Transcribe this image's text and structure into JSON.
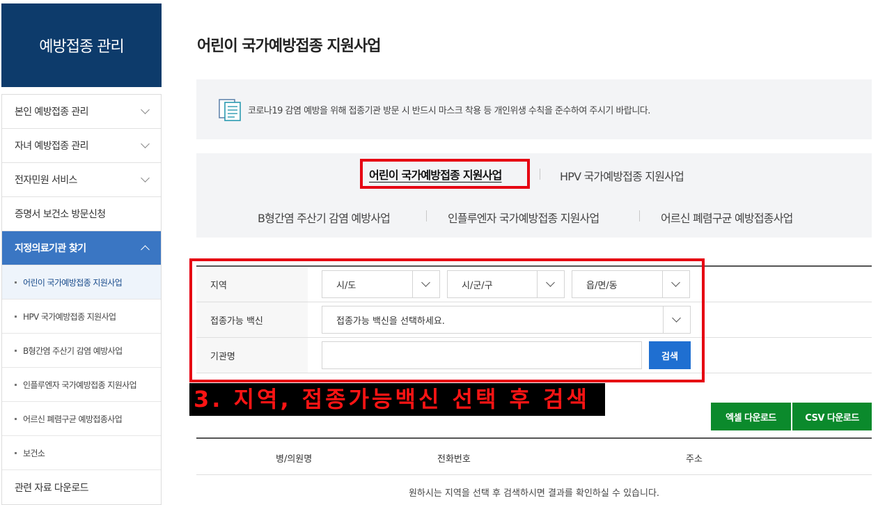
{
  "sidebar": {
    "title": "예방접종 관리",
    "items": [
      {
        "label": "본인 예방접종 관리"
      },
      {
        "label": "자녀 예방접종 관리"
      },
      {
        "label": "전자민원 서비스"
      },
      {
        "label": "증명서 보건소 방문신청"
      },
      {
        "label": "지정의료기관 찾기"
      }
    ],
    "sub_items": [
      {
        "label": "어린이 국가예방접종 지원사업"
      },
      {
        "label": "HPV 국가예방접종 지원사업"
      },
      {
        "label": "B형간염 주산기 감염 예방사업"
      },
      {
        "label": "인플루엔자 국가예방접종 지원사업"
      },
      {
        "label": "어르신 폐렴구균 예방접종사업"
      },
      {
        "label": "보건소"
      }
    ],
    "footer_item": {
      "label": "관련 자료 다운로드"
    }
  },
  "main": {
    "title": "어린이 국가예방접종 지원사업",
    "notice": "코로나19 감염 예방을 위해 접종기관 방문 시 반드시 마스크 착용 등 개인위생 수칙을 준수하여 주시기 바랍니다.",
    "tabs": [
      {
        "label": "어린이 국가예방접종 지원사업"
      },
      {
        "label": "HPV 국가예방접종 지원사업"
      },
      {
        "label": "B형간염 주산기 감염 예방사업"
      },
      {
        "label": "인플루엔자 국가예방접종 지원사업"
      },
      {
        "label": "어르신 폐렴구균 예방접종사업"
      }
    ],
    "form": {
      "region_label": "지역",
      "sido": "시/도",
      "sigungu": "시/군/구",
      "dong": "읍/면/동",
      "vaccine_label": "접종가능 백신",
      "vaccine_value": "접종가능 백신을 선택하세요.",
      "org_label": "기관명",
      "org_value": "",
      "search_label": "검색"
    },
    "annotation": "3. 지역, 접종가능백신 선택 후 검색",
    "excel_label": "엑셀 다운로드",
    "csv_label": "CSV 다운로드",
    "table": {
      "columns": [
        "병/의원명",
        "전화번호",
        "주소"
      ],
      "empty": "원하시는 지역을 선택 후 검색하시면 결과를 확인하실 수 있습니다."
    }
  },
  "colors": {
    "header_navy": "#0d3b6b",
    "active_blue": "#3a76c3",
    "search_blue": "#1f6fd1",
    "download_green": "#0b8a2c",
    "highlight_red": "#e60012"
  }
}
